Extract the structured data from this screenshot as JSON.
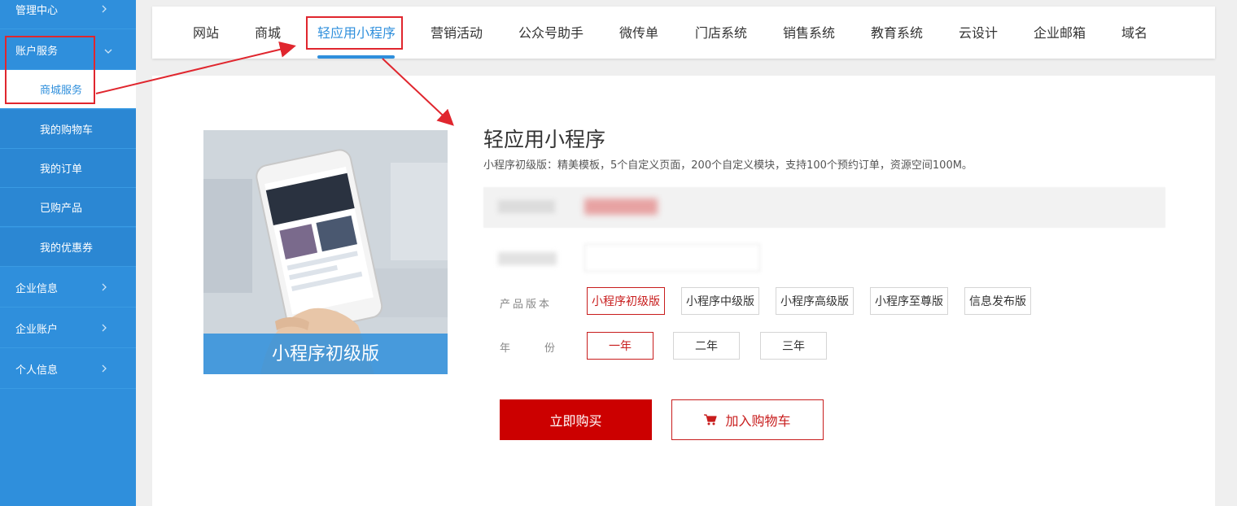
{
  "sidebar": {
    "items": [
      {
        "label": "管理中心"
      },
      {
        "label": "账户服务"
      },
      {
        "label": "商城服务"
      },
      {
        "label": "我的购物车"
      },
      {
        "label": "我的订单"
      },
      {
        "label": "已购产品"
      },
      {
        "label": "我的优惠券"
      },
      {
        "label": "企业信息"
      },
      {
        "label": "企业账户"
      },
      {
        "label": "个人信息"
      }
    ]
  },
  "tabs": [
    {
      "label": "网站"
    },
    {
      "label": "商城"
    },
    {
      "label": "轻应用小程序"
    },
    {
      "label": "营销活动"
    },
    {
      "label": "公众号助手"
    },
    {
      "label": "微传单"
    },
    {
      "label": "门店系统"
    },
    {
      "label": "销售系统"
    },
    {
      "label": "教育系统"
    },
    {
      "label": "云设计"
    },
    {
      "label": "企业邮箱"
    },
    {
      "label": "域名"
    }
  ],
  "product": {
    "image_caption": "小程序初级版",
    "title": "轻应用小程序",
    "description": "小程序初级版：精美模板，5个自定义页面，200个自定义模块，支持100个预约订单，资源空间100M。"
  },
  "options": {
    "version_label": "产品版本",
    "versions": [
      "小程序初级版",
      "小程序中级版",
      "小程序高级版",
      "小程序至尊版",
      "信息发布版"
    ],
    "selected_version": "小程序初级版",
    "year_label": "年  份",
    "years": [
      "一年",
      "二年",
      "三年"
    ],
    "selected_year": "一年"
  },
  "actions": {
    "buy_label": "立即购买",
    "cart_label": "加入购物车"
  },
  "colors": {
    "sidebar": "#2f8fdc",
    "accent": "#2f8fdc",
    "primary_red": "#cc0000",
    "annotation": "#e0262e"
  }
}
